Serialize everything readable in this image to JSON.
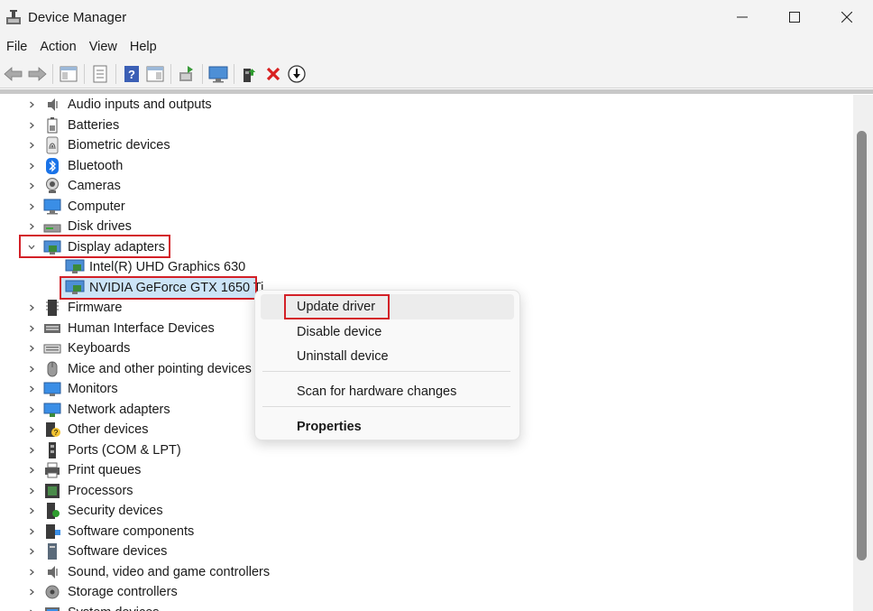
{
  "window": {
    "title": "Device Manager"
  },
  "menu": [
    "File",
    "Action",
    "View",
    "Help"
  ],
  "toolbar": [
    "back-icon",
    "forward-icon",
    "show-hide-console-tree-icon",
    "properties-icon",
    "help-icon",
    "action-pane-icon",
    "scan-hardware-icon",
    "display-icon",
    "add-driver-icon",
    "uninstall-icon",
    "update-driver-icon"
  ],
  "tree": {
    "categories": [
      {
        "label": "Audio inputs and outputs",
        "icon": "speaker-icon"
      },
      {
        "label": "Batteries",
        "icon": "battery-icon"
      },
      {
        "label": "Biometric devices",
        "icon": "fingerprint-icon"
      },
      {
        "label": "Bluetooth",
        "icon": "bluetooth-icon"
      },
      {
        "label": "Cameras",
        "icon": "camera-icon"
      },
      {
        "label": "Computer",
        "icon": "computer-icon"
      },
      {
        "label": "Disk drives",
        "icon": "disk-icon"
      },
      {
        "label": "Display adapters",
        "icon": "display-adapter-icon",
        "expanded": true
      },
      {
        "label": "Firmware",
        "icon": "firmware-icon"
      },
      {
        "label": "Human Interface Devices",
        "icon": "hid-icon"
      },
      {
        "label": "Keyboards",
        "icon": "keyboard-icon"
      },
      {
        "label": "Mice and other pointing devices",
        "icon": "mouse-icon"
      },
      {
        "label": "Monitors",
        "icon": "monitor-icon"
      },
      {
        "label": "Network adapters",
        "icon": "network-icon"
      },
      {
        "label": "Other devices",
        "icon": "other-devices-icon"
      },
      {
        "label": "Ports (COM & LPT)",
        "icon": "port-icon"
      },
      {
        "label": "Print queues",
        "icon": "printer-icon"
      },
      {
        "label": "Processors",
        "icon": "processor-icon"
      },
      {
        "label": "Security devices",
        "icon": "security-icon"
      },
      {
        "label": "Software components",
        "icon": "software-components-icon"
      },
      {
        "label": "Software devices",
        "icon": "software-devices-icon"
      },
      {
        "label": "Sound, video and game controllers",
        "icon": "sound-icon"
      },
      {
        "label": "Storage controllers",
        "icon": "storage-icon"
      },
      {
        "label": "System devices",
        "icon": "system-icon"
      }
    ],
    "display_children": [
      {
        "label": "Intel(R) UHD Graphics 630"
      },
      {
        "label": "NVIDIA GeForce GTX 1650 Ti",
        "selected": true
      }
    ]
  },
  "context_menu": {
    "items": [
      {
        "label": "Update driver",
        "hover": true
      },
      {
        "label": "Disable device"
      },
      {
        "label": "Uninstall device"
      },
      {
        "label": "Scan for hardware changes"
      },
      {
        "label": "Properties",
        "bold": true
      }
    ]
  },
  "colors": {
    "highlight": "#d32027",
    "selection": "#cce4f7"
  }
}
